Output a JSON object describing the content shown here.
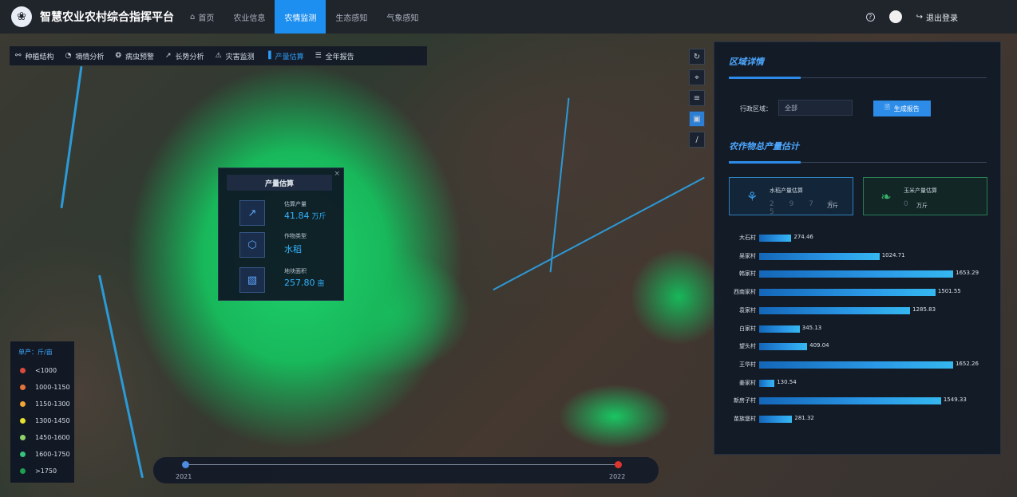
{
  "app": {
    "title": "智慧农业农村综合指挥平台",
    "logo_icon": "leaf-swirl-icon"
  },
  "nav": {
    "items": [
      {
        "label": "首页",
        "icon": "home-icon",
        "active": false
      },
      {
        "label": "农业信息",
        "active": false
      },
      {
        "label": "农情监测",
        "active": true
      },
      {
        "label": "生态感知",
        "active": false
      },
      {
        "label": "气象感知",
        "active": false
      }
    ]
  },
  "header_right": {
    "help_icon": "help-icon",
    "logout_label": "退出登录",
    "logout_icon": "logout-icon"
  },
  "toolbar": {
    "tabs": [
      {
        "label": "种植结构",
        "icon": "link-icon",
        "active": false
      },
      {
        "label": "墒情分析",
        "icon": "gauge-icon",
        "active": false
      },
      {
        "label": "病虫预警",
        "icon": "bug-icon",
        "active": false
      },
      {
        "label": "长势分析",
        "icon": "growth-icon",
        "active": false
      },
      {
        "label": "灾害监测",
        "icon": "disaster-icon",
        "active": false
      },
      {
        "label": "产量估算",
        "icon": "bar-chart-icon",
        "active": true
      },
      {
        "label": "全年报告",
        "icon": "report-icon",
        "active": false
      }
    ]
  },
  "popup": {
    "title": "产量估算",
    "close": "×",
    "rows": [
      {
        "label": "估算产量",
        "value": "41.84",
        "unit": "万斤",
        "icon": "trend-chart-icon"
      },
      {
        "label": "作物类型",
        "value": "水稻",
        "unit": "",
        "icon": "cube-icon"
      },
      {
        "label": "地块面积",
        "value": "257.80",
        "unit": "亩",
        "icon": "area-icon"
      }
    ]
  },
  "map_controls": [
    {
      "icon": "rotate-icon",
      "active": false
    },
    {
      "icon": "locate-icon",
      "active": false
    },
    {
      "icon": "layers-icon",
      "active": false
    },
    {
      "icon": "image-icon",
      "active": true
    },
    {
      "icon": "ruler-icon",
      "active": false
    }
  ],
  "legend": {
    "title": "单产：斤/亩",
    "items": [
      {
        "label": "<1000",
        "color": "#d94a3b"
      },
      {
        "label": "1000-1150",
        "color": "#e4733a"
      },
      {
        "label": "1150-1300",
        "color": "#f0a43a"
      },
      {
        "label": "1300-1450",
        "color": "#e8df2e"
      },
      {
        "label": "1450-1600",
        "color": "#8fd26a"
      },
      {
        "label": "1600-1750",
        "color": "#35c27a"
      },
      {
        "label": ">1750",
        "color": "#1e9e4e"
      }
    ]
  },
  "timeline": {
    "start_label": "2021",
    "end_label": "2022",
    "start_color": "#4c8be0",
    "end_color": "#e0352b"
  },
  "panel": {
    "section1_title": "区域详情",
    "region_label": "行政区域：",
    "region_value": "全部",
    "report_button": "生成报告",
    "report_icon": "document-icon",
    "section2_title": "农作物总产量估计",
    "rice": {
      "label": "水稻产量估算",
      "digits": "2 9 7 8 5",
      "unit": "万斤",
      "icon": "rice-icon"
    },
    "corn": {
      "label": "玉米产量估算",
      "digits": "0",
      "unit": "万斤",
      "icon": "corn-icon"
    }
  },
  "chart_data": {
    "type": "bar",
    "orientation": "horizontal",
    "categories": [
      "大石村",
      "吴家村",
      "韩家村",
      "西南家村",
      "袁家村",
      "白家村",
      "望头村",
      "王华村",
      "姜家村",
      "新房子村",
      "苗族堡村"
    ],
    "values": [
      274.46,
      1024.71,
      1653.29,
      1501.55,
      1285.83,
      345.13,
      409.04,
      1652.26,
      130.54,
      1549.33,
      281.32
    ],
    "value_labels": [
      "274.46",
      "1024.71",
      "1653.29",
      "1501.55",
      "1285.83",
      "345.13",
      "409.04",
      "1652.26",
      "130.54",
      "1549.33",
      "281.32"
    ],
    "xlim": [
      0,
      1700
    ],
    "grid": false
  }
}
